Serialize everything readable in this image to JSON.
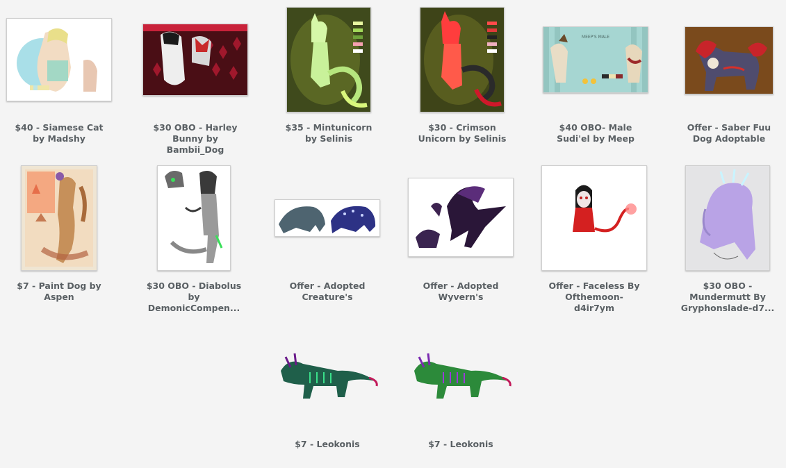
{
  "items": [
    {
      "title_lines": [
        "$40 - Siamese Cat",
        "by Madshy"
      ],
      "image": "siamese-cat-art"
    },
    {
      "title_lines": [
        "$30 OBO - Harley",
        "Bunny by",
        "Bambii_Dog"
      ],
      "image": "harley-bunny-art"
    },
    {
      "title_lines": [
        "$35 - Mintunicorn",
        "by Selinis"
      ],
      "image": "mintunicorn-art"
    },
    {
      "title_lines": [
        "$30 - Crimson",
        "Unicorn by Selinis"
      ],
      "image": "crimson-unicorn-art"
    },
    {
      "title_lines": [
        "$40 OBO- Male",
        "Sudi'el by Meep"
      ],
      "image": "sudiel-ref-art",
      "image_text": "MEEP'S MALE"
    },
    {
      "title_lines": [
        "Offer - Saber Fuu",
        "Dog Adoptable"
      ],
      "image": "saber-fuu-dog-art"
    },
    {
      "title_lines": [
        "$7 - Paint Dog by",
        "Aspen"
      ],
      "image": "paint-dog-art"
    },
    {
      "title_lines": [
        "$30 OBO - Diabolus",
        "by",
        "DemonicCompen..."
      ],
      "image": "diabolus-art"
    },
    {
      "title_lines": [
        "Offer - Adopted",
        "Creature's"
      ],
      "image": "creatures-art"
    },
    {
      "title_lines": [
        "Offer - Adopted",
        "Wyvern's"
      ],
      "image": "wyverns-art"
    },
    {
      "title_lines": [
        "Offer - Faceless By",
        "Ofthemoon-",
        "d4ir7ym"
      ],
      "image": "faceless-art"
    },
    {
      "title_lines": [
        "$30 OBO -",
        "Mundermutt By",
        "Gryphonslade-d7..."
      ],
      "image": "mundermutt-art"
    },
    {
      "title_lines": [
        "$7 - Leokonis"
      ],
      "image": "leokonis-art-1"
    },
    {
      "title_lines": [
        "$7 - Leokonis"
      ],
      "image": "leokonis-art-2"
    }
  ]
}
